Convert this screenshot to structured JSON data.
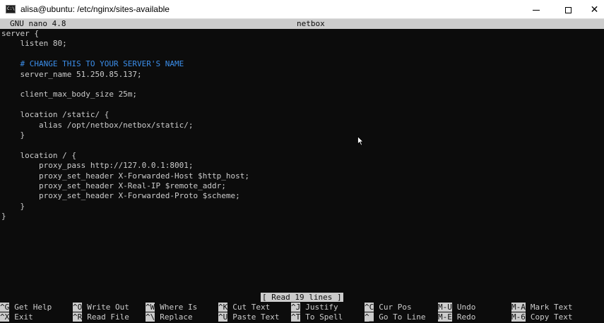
{
  "window": {
    "app_icon_text": "C:\\.",
    "title": "alisa@ubuntu: /etc/nginx/sites-available",
    "controls": {
      "minimize_icon": "minimize-icon",
      "maximize_icon": "maximize-icon",
      "close_icon": "close-icon",
      "close_glyph": "✕"
    }
  },
  "nano": {
    "version": "GNU nano 4.8",
    "filename": "netbox",
    "lines": [
      {
        "text": "server {",
        "type": "code"
      },
      {
        "text": "    listen 80;",
        "type": "code"
      },
      {
        "text": "",
        "type": "code"
      },
      {
        "text": "    # CHANGE THIS TO YOUR SERVER'S NAME",
        "type": "comment"
      },
      {
        "text": "    server_name 51.250.85.137;",
        "type": "code"
      },
      {
        "text": "",
        "type": "code"
      },
      {
        "text": "    client_max_body_size 25m;",
        "type": "code"
      },
      {
        "text": "",
        "type": "code"
      },
      {
        "text": "    location /static/ {",
        "type": "code"
      },
      {
        "text": "        alias /opt/netbox/netbox/static/;",
        "type": "code"
      },
      {
        "text": "    }",
        "type": "code"
      },
      {
        "text": "",
        "type": "code"
      },
      {
        "text": "    location / {",
        "type": "code"
      },
      {
        "text": "        proxy_pass http://127.0.0.1:8001;",
        "type": "code"
      },
      {
        "text": "        proxy_set_header X-Forwarded-Host $http_host;",
        "type": "code"
      },
      {
        "text": "        proxy_set_header X-Real-IP $remote_addr;",
        "type": "code"
      },
      {
        "text": "        proxy_set_header X-Forwarded-Proto $scheme;",
        "type": "code"
      },
      {
        "text": "    }",
        "type": "code"
      },
      {
        "text": "}",
        "type": "code"
      }
    ],
    "status": "[ Read 19 lines ]",
    "shortcuts_row1": [
      {
        "key": "^G",
        "label": "Get Help"
      },
      {
        "key": "^O",
        "label": "Write Out"
      },
      {
        "key": "^W",
        "label": "Where Is"
      },
      {
        "key": "^K",
        "label": "Cut Text"
      },
      {
        "key": "^J",
        "label": "Justify"
      },
      {
        "key": "^C",
        "label": "Cur Pos"
      },
      {
        "key": "M-U",
        "label": "Undo"
      },
      {
        "key": "M-A",
        "label": "Mark Text"
      }
    ],
    "shortcuts_row2": [
      {
        "key": "^X",
        "label": "Exit"
      },
      {
        "key": "^R",
        "label": "Read File"
      },
      {
        "key": "^\\",
        "label": "Replace"
      },
      {
        "key": "^U",
        "label": "Paste Text"
      },
      {
        "key": "^T",
        "label": "To Spell"
      },
      {
        "key": "^_",
        "label": "Go To Line"
      },
      {
        "key": "M-E",
        "label": "Redo"
      },
      {
        "key": "M-6",
        "label": "Copy Text"
      }
    ]
  },
  "colors": {
    "terminal_bg": "#0c0c0c",
    "terminal_fg": "#cccccc",
    "comment": "#3b8eea",
    "inverse_bg": "#cccccc"
  }
}
